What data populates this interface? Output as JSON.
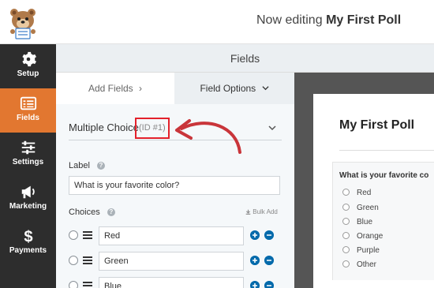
{
  "header": {
    "editing_prefix": "Now editing",
    "form_name": "My First Poll"
  },
  "sidebar": {
    "items": [
      {
        "label": "Setup",
        "icon": "gear-icon"
      },
      {
        "label": "Fields",
        "icon": "fields-list-icon",
        "active": true
      },
      {
        "label": "Settings",
        "icon": "sliders-icon"
      },
      {
        "label": "Marketing",
        "icon": "megaphone-icon"
      },
      {
        "label": "Payments",
        "icon": "dollar-icon"
      }
    ]
  },
  "panel": {
    "title": "Fields",
    "tabs": {
      "add_fields": "Add Fields",
      "field_options": "Field Options"
    }
  },
  "field_options": {
    "field_type": "Multiple Choice",
    "field_id": "(ID #1)",
    "label_heading": "Label",
    "label_value": "What is your favorite color?",
    "choices_heading": "Choices",
    "bulk_add": "Bulk Add",
    "choices": [
      "Red",
      "Green",
      "Blue"
    ]
  },
  "preview": {
    "title": "My First Poll",
    "question": "What is your favorite co",
    "options": [
      "Red",
      "Green",
      "Blue",
      "Orange",
      "Purple",
      "Other"
    ]
  },
  "colors": {
    "sidebar_bg": "#2d2d2d",
    "active_orange": "#e27730",
    "highlight_red": "#e3212b",
    "arrow_red": "#c9353a",
    "action_blue": "#036aab"
  }
}
